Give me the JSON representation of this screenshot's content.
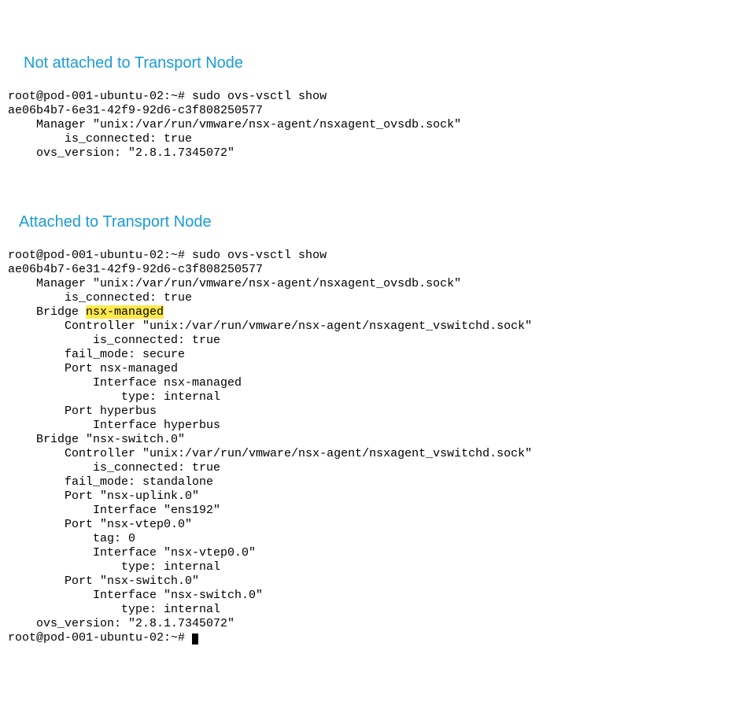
{
  "heading1": "Not attached to Transport Node",
  "block1": {
    "l0": "root@pod-001-ubuntu-02:~# sudo ovs-vsctl show",
    "l1": "ae06b4b7-6e31-42f9-92d6-c3f808250577",
    "l2": "    Manager \"unix:/var/run/vmware/nsx-agent/nsxagent_ovsdb.sock\"",
    "l3": "        is_connected: true",
    "l4": "    ovs_version: \"2.8.1.7345072\""
  },
  "heading2": "Attached to Transport Node",
  "block2": {
    "l0": "root@pod-001-ubuntu-02:~# sudo ovs-vsctl show",
    "l1": "ae06b4b7-6e31-42f9-92d6-c3f808250577",
    "l2": "    Manager \"unix:/var/run/vmware/nsx-agent/nsxagent_ovsdb.sock\"",
    "l3": "        is_connected: true",
    "l4a": "    Bridge ",
    "l4b": "nsx-managed",
    "l5": "        Controller \"unix:/var/run/vmware/nsx-agent/nsxagent_vswitchd.sock\"",
    "l6": "            is_connected: true",
    "l7": "        fail_mode: secure",
    "l8": "        Port nsx-managed",
    "l9": "            Interface nsx-managed",
    "l10": "                type: internal",
    "l11": "        Port hyperbus",
    "l12": "            Interface hyperbus",
    "l13": "    Bridge \"nsx-switch.0\"",
    "l14": "        Controller \"unix:/var/run/vmware/nsx-agent/nsxagent_vswitchd.sock\"",
    "l15": "            is_connected: true",
    "l16": "        fail_mode: standalone",
    "l17": "        Port \"nsx-uplink.0\"",
    "l18": "            Interface \"ens192\"",
    "l19": "        Port \"nsx-vtep0.0\"",
    "l20": "            tag: 0",
    "l21": "            Interface \"nsx-vtep0.0\"",
    "l22": "                type: internal",
    "l23": "        Port \"nsx-switch.0\"",
    "l24": "            Interface \"nsx-switch.0\"",
    "l25": "                type: internal",
    "l26": "    ovs_version: \"2.8.1.7345072\"",
    "l27": "root@pod-001-ubuntu-02:~# "
  }
}
